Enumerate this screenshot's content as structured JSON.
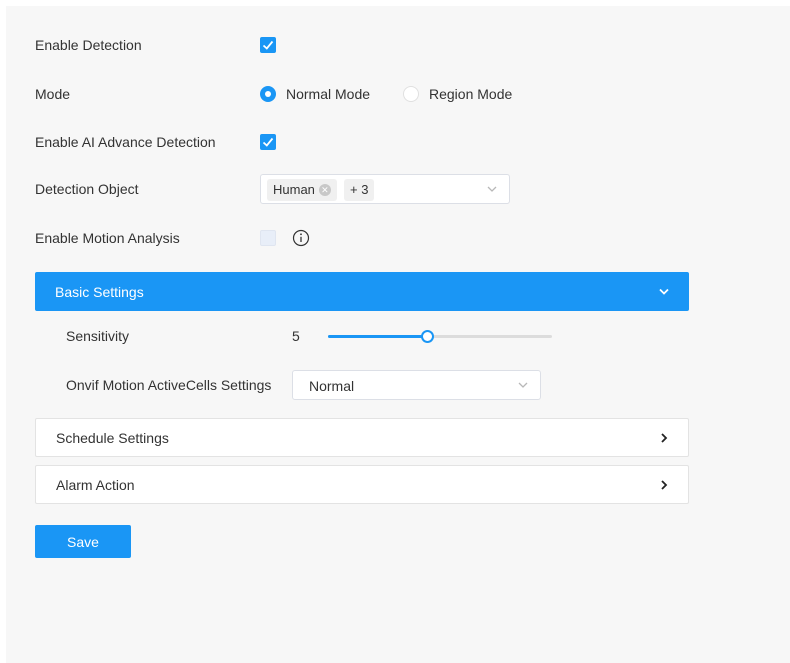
{
  "form": {
    "enable_detection": {
      "label": "Enable Detection",
      "checked": true
    },
    "mode": {
      "label": "Mode",
      "options": [
        {
          "label": "Normal Mode",
          "selected": true
        },
        {
          "label": "Region Mode",
          "selected": false
        }
      ]
    },
    "enable_ai": {
      "label": "Enable AI Advance Detection",
      "checked": true
    },
    "detection_object": {
      "label": "Detection Object",
      "chips": [
        "Human"
      ],
      "more": "+ 3"
    },
    "enable_motion": {
      "label": "Enable Motion Analysis",
      "checked": false,
      "info_icon": "info-icon"
    }
  },
  "basic_settings": {
    "title": "Basic Settings",
    "expanded": true,
    "sensitivity": {
      "label": "Sensitivity",
      "value": "5",
      "level": 0.44
    },
    "onvif": {
      "label": "Onvif Motion ActiveCells Settings",
      "value": "Normal"
    }
  },
  "schedule_settings": {
    "title": "Schedule Settings",
    "expanded": false
  },
  "alarm_action": {
    "title": "Alarm Action",
    "expanded": false
  },
  "save_label": "Save",
  "colors": {
    "accent": "#1a96f5",
    "panel_bg": "#f7f7f7"
  }
}
